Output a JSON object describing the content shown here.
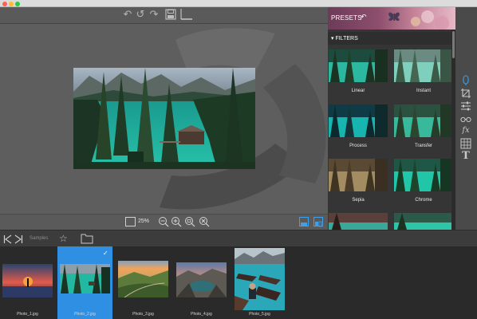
{
  "window": {
    "controls": [
      "close",
      "minimize",
      "zoom"
    ]
  },
  "toolbar": {
    "icons": [
      "undo-icon",
      "undo-alt-icon",
      "redo-icon",
      "save-icon",
      "crop-tool-icon"
    ]
  },
  "zoom": {
    "percent": "25%"
  },
  "presets": {
    "title": "PRESETS"
  },
  "filters": {
    "title": "FILTERS",
    "items": [
      {
        "label": "Linear"
      },
      {
        "label": "Instant"
      },
      {
        "label": "Process"
      },
      {
        "label": "Transfer"
      },
      {
        "label": "Sepia"
      },
      {
        "label": "Chrome"
      }
    ]
  },
  "tools": [
    "paint-tool-icon",
    "crop-icon",
    "adjust-icon",
    "glasses-icon",
    "fx-icon",
    "texture-icon",
    "text-icon"
  ],
  "filmbar": {
    "label": "Samples"
  },
  "photos": [
    {
      "name": "Photo_1.jpg",
      "selected": false
    },
    {
      "name": "Photo_2.jpg",
      "selected": true
    },
    {
      "name": "Photo_3.jpg",
      "selected": false
    },
    {
      "name": "Photo_4.jpg",
      "selected": false
    },
    {
      "name": "Photo_5.jpg",
      "selected": false
    }
  ],
  "colors": {
    "accent": "#2f8fe3",
    "teal_water": "#1fb7a4",
    "forest": "#23412c"
  }
}
